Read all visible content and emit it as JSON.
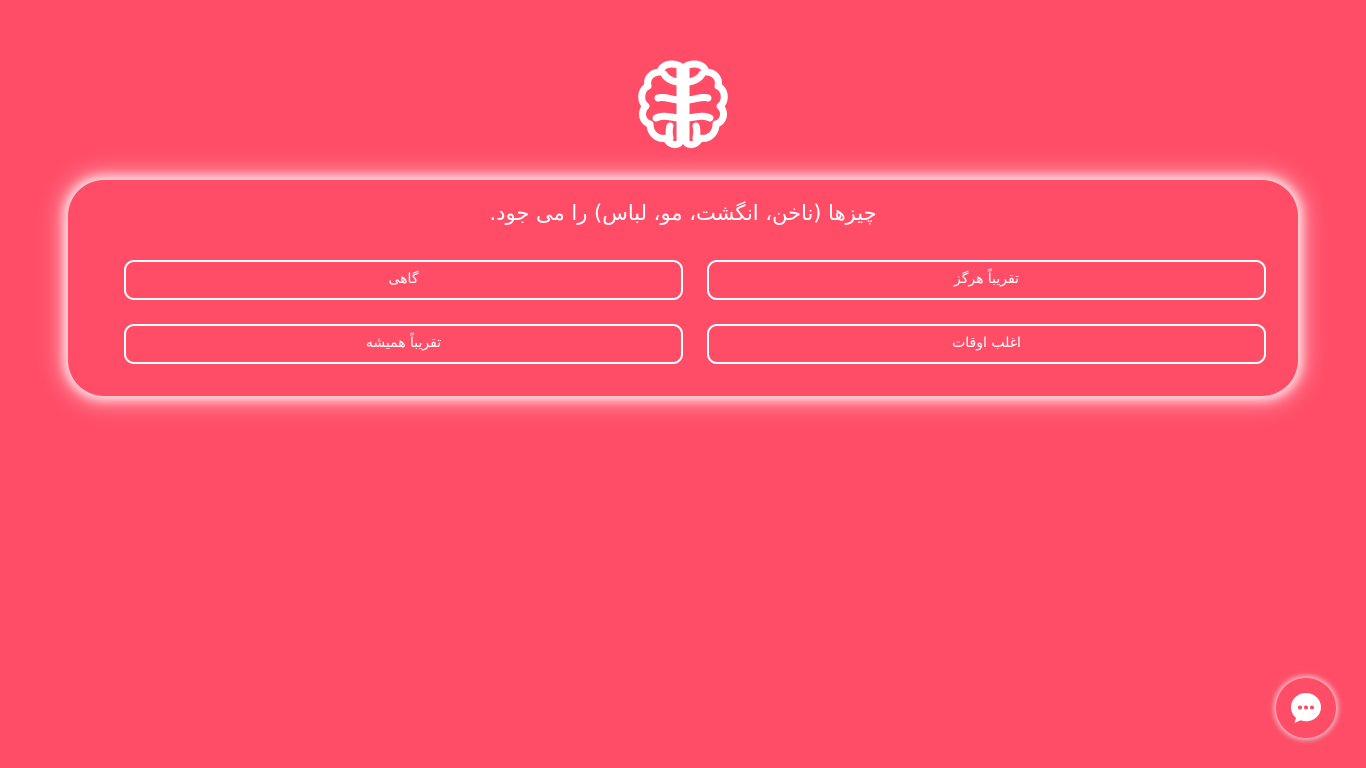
{
  "colors": {
    "background": "#ff4d67",
    "foreground": "#ffffff"
  },
  "logo": {
    "icon": "brain-icon"
  },
  "question": {
    "text": "چیزها (ناخن، انگشت، مو، لباس) را می جود."
  },
  "options": [
    {
      "label": "تقریباً هرگز"
    },
    {
      "label": "گاهی"
    },
    {
      "label": "اغلب اوقات"
    },
    {
      "label": "تقریباً همیشه"
    }
  ],
  "chat": {
    "icon": "chat-bubble-icon"
  }
}
